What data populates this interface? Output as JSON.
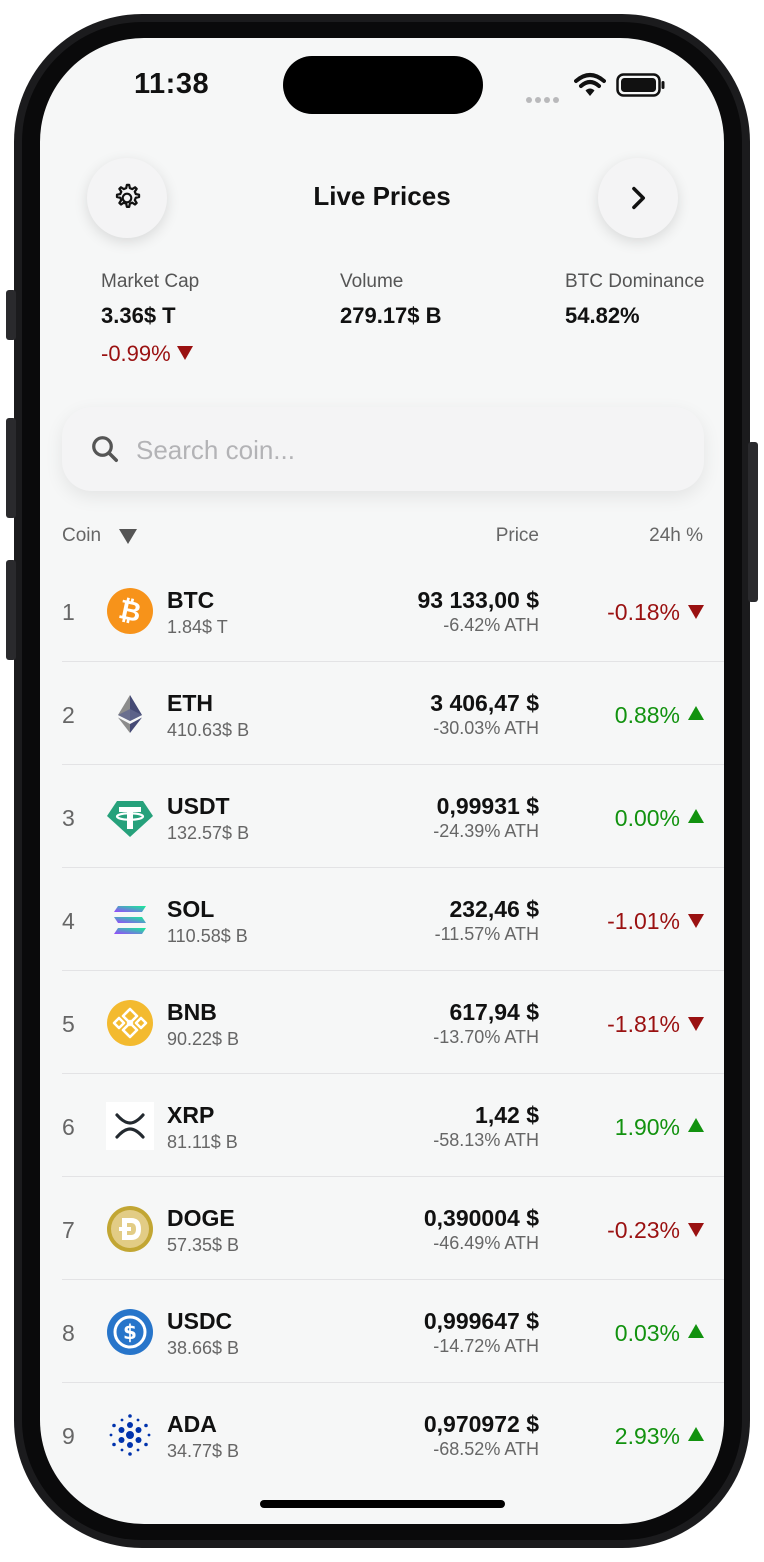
{
  "status_bar": {
    "time": "11:38"
  },
  "header": {
    "title": "Live Prices",
    "settings_icon": "gear-icon",
    "next_icon": "chevron-right-icon"
  },
  "stats": {
    "market_cap": {
      "label": "Market Cap",
      "value": "3.36$ T",
      "change": "-0.99%"
    },
    "volume": {
      "label": "Volume",
      "value": "279.17$ B"
    },
    "btc_dominance": {
      "label": "BTC Dominance",
      "value": "54.82%"
    }
  },
  "search": {
    "placeholder": "Search coin..."
  },
  "columns": {
    "coin": "Coin",
    "price": "Price",
    "change": "24h %"
  },
  "colors": {
    "down": "#9a1111",
    "up": "#12920f",
    "background": "#f6f7f7"
  },
  "coins": [
    {
      "rank": "1",
      "symbol": "BTC",
      "mcap": "1.84$ T",
      "price": "93 133,00 $",
      "ath": "-6.42% ATH",
      "change": "-0.18%",
      "direction": "down",
      "icon": "btc-logo-icon"
    },
    {
      "rank": "2",
      "symbol": "ETH",
      "mcap": "410.63$ B",
      "price": "3 406,47 $",
      "ath": "-30.03% ATH",
      "change": "0.88%",
      "direction": "up",
      "icon": "eth-logo-icon"
    },
    {
      "rank": "3",
      "symbol": "USDT",
      "mcap": "132.57$ B",
      "price": "0,99931 $",
      "ath": "-24.39% ATH",
      "change": "0.00%",
      "direction": "up",
      "icon": "usdt-logo-icon"
    },
    {
      "rank": "4",
      "symbol": "SOL",
      "mcap": "110.58$ B",
      "price": "232,46 $",
      "ath": "-11.57% ATH",
      "change": "-1.01%",
      "direction": "down",
      "icon": "sol-logo-icon"
    },
    {
      "rank": "5",
      "symbol": "BNB",
      "mcap": "90.22$ B",
      "price": "617,94 $",
      "ath": "-13.70% ATH",
      "change": "-1.81%",
      "direction": "down",
      "icon": "bnb-logo-icon"
    },
    {
      "rank": "6",
      "symbol": "XRP",
      "mcap": "81.11$ B",
      "price": "1,42 $",
      "ath": "-58.13% ATH",
      "change": "1.90%",
      "direction": "up",
      "icon": "xrp-logo-icon"
    },
    {
      "rank": "7",
      "symbol": "DOGE",
      "mcap": "57.35$ B",
      "price": "0,390004 $",
      "ath": "-46.49% ATH",
      "change": "-0.23%",
      "direction": "down",
      "icon": "doge-logo-icon"
    },
    {
      "rank": "8",
      "symbol": "USDC",
      "mcap": "38.66$ B",
      "price": "0,999647 $",
      "ath": "-14.72% ATH",
      "change": "0.03%",
      "direction": "up",
      "icon": "usdc-logo-icon"
    },
    {
      "rank": "9",
      "symbol": "ADA",
      "mcap": "34.77$ B",
      "price": "0,970972 $",
      "ath": "-68.52% ATH",
      "change": "2.93%",
      "direction": "up",
      "icon": "ada-logo-icon"
    }
  ]
}
